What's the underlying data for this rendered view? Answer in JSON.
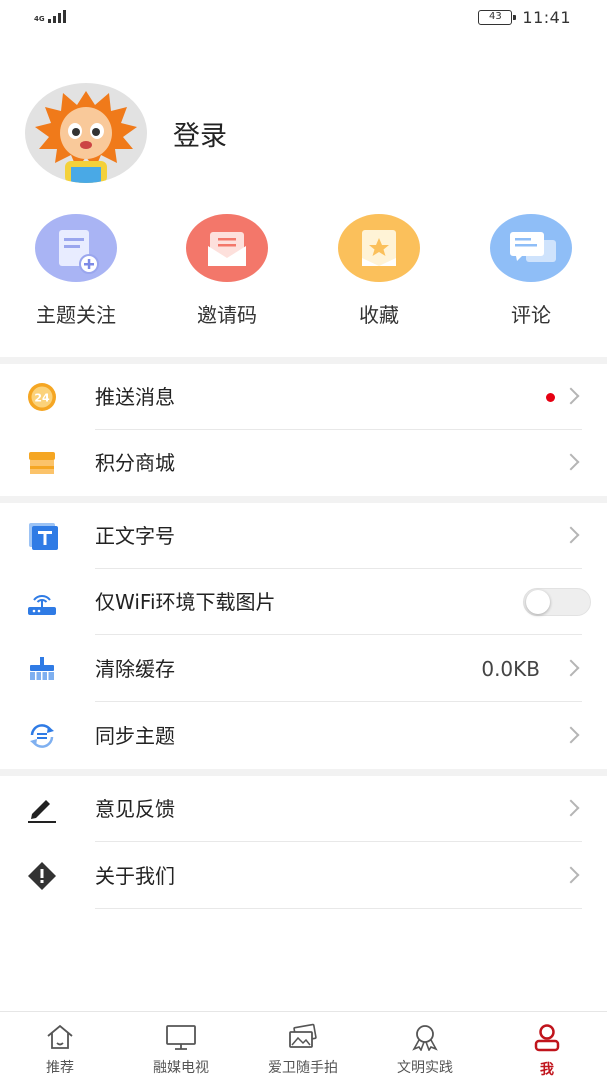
{
  "status_bar": {
    "network": "4G",
    "battery": "43",
    "time": "11:41"
  },
  "profile": {
    "login_label": "登录",
    "avatar_icon": "cartoon-mascot-avatar"
  },
  "quick_actions": [
    {
      "label": "主题关注",
      "icon": "topic-follow-icon",
      "color": "#a9b4f4"
    },
    {
      "label": "邀请码",
      "icon": "invite-code-icon",
      "color": "#f3776a"
    },
    {
      "label": "收藏",
      "icon": "favorites-icon",
      "color": "#fbc05b"
    },
    {
      "label": "评论",
      "icon": "comments-icon",
      "color": "#8fbef7"
    }
  ],
  "menu_group1": [
    {
      "label": "推送消息",
      "icon": "push-24-icon",
      "has_red_dot": true
    },
    {
      "label": "积分商城",
      "icon": "shop-icon"
    }
  ],
  "menu_group2": [
    {
      "label": "正文字号",
      "icon": "font-size-icon"
    },
    {
      "label": "仅WiFi环境下载图片",
      "icon": "wifi-router-icon",
      "toggle": false
    },
    {
      "label": "清除缓存",
      "icon": "broom-icon",
      "value": "0.0KB"
    },
    {
      "label": "同步主题",
      "icon": "sync-icon"
    }
  ],
  "menu_group3": [
    {
      "label": "意见反馈",
      "icon": "pen-icon"
    },
    {
      "label": "关于我们",
      "icon": "warning-diamond-icon"
    }
  ],
  "tabs": [
    {
      "label": "推荐",
      "icon": "home-icon"
    },
    {
      "label": "融媒电视",
      "icon": "tv-icon"
    },
    {
      "label": "爱卫随手拍",
      "icon": "photo-cards-icon"
    },
    {
      "label": "文明实践",
      "icon": "ribbon-badge-icon"
    },
    {
      "label": "我",
      "icon": "person-icon",
      "active": true
    }
  ],
  "colors": {
    "accent": "#c0141c",
    "divider": "#f2f2f2",
    "chevron": "#b5b5b5",
    "icon_blue": "#2f7be5",
    "icon_orange": "#f5a623"
  }
}
